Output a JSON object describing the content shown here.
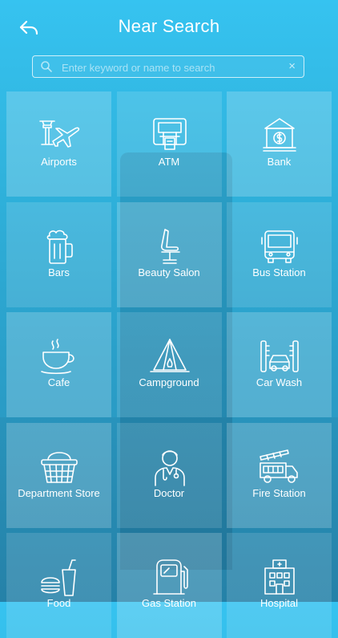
{
  "header": {
    "title": "Near Search"
  },
  "search": {
    "placeholder": "Enter keyword or name to search",
    "clear_glyph": "×"
  },
  "categories": [
    {
      "label": "Airports",
      "icon": "airport-icon"
    },
    {
      "label": "ATM",
      "icon": "atm-icon"
    },
    {
      "label": "Bank",
      "icon": "bank-icon"
    },
    {
      "label": "Bars",
      "icon": "beer-icon"
    },
    {
      "label": "Beauty Salon",
      "icon": "salon-chair-icon"
    },
    {
      "label": "Bus Station",
      "icon": "bus-icon"
    },
    {
      "label": "Cafe",
      "icon": "coffee-cup-icon"
    },
    {
      "label": "Campground",
      "icon": "tent-icon"
    },
    {
      "label": "Car Wash",
      "icon": "car-wash-icon"
    },
    {
      "label": "Department Store",
      "icon": "basket-icon"
    },
    {
      "label": "Doctor",
      "icon": "doctor-icon"
    },
    {
      "label": "Fire Station",
      "icon": "fire-truck-icon"
    },
    {
      "label": "Food",
      "icon": "fast-food-icon"
    },
    {
      "label": "Gas Station",
      "icon": "gas-pump-icon"
    },
    {
      "label": "Hospital",
      "icon": "hospital-icon"
    }
  ]
}
